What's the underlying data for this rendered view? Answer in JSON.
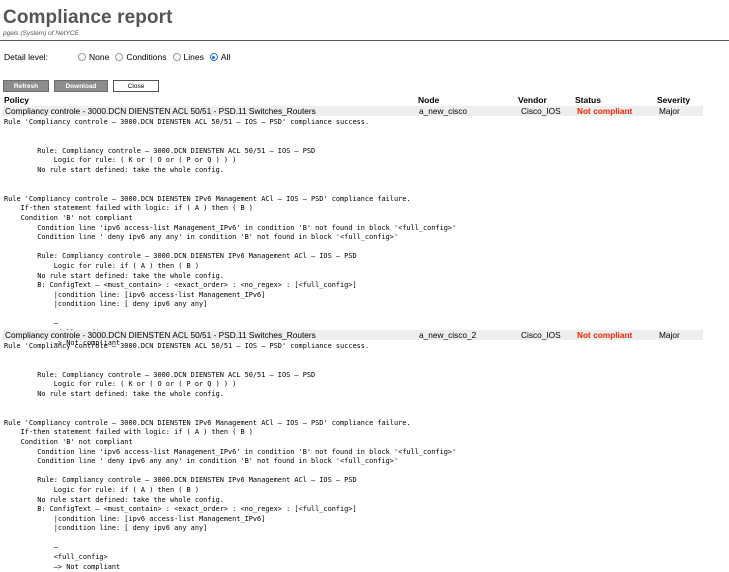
{
  "title": "Compliance report",
  "subtitle": "pgels (System) of NetYCE",
  "detail": {
    "label": "Detail level:",
    "options": [
      "None",
      "Conditions",
      "Lines",
      "All"
    ],
    "selected": "All"
  },
  "buttons": {
    "refresh": "Refresh",
    "download": "Download",
    "close": "Close"
  },
  "columns": {
    "policy": "Policy",
    "node": "Node",
    "vendor": "Vendor",
    "status": "Status",
    "severity": "Severity"
  },
  "rows": [
    {
      "policy": "Compliancy controle - 3000.DCN DIENSTEN ACL 50/51 - PSD.11 Switches_Routers",
      "node": "a_new_cisco",
      "vendor": "Cisco_IOS",
      "status": "Not compliant",
      "severity": "Major",
      "log": "Rule 'Compliancy controle – 3000.DCN DIENSTEN ACL 50/51 – IOS – PSD' compliance success.\n\n\n        Rule: Compliancy controle – 3000.DCN DIENSTEN ACL 50/51 – IOS – PSD\n            Logic for rule: ( K or ( O or ( P or Q ) ) )\n        No rule start defined: take the whole config.\n\n\nRule 'Compliancy controle – 3000.DCN DIENSTEN IPv6 Management ACl – IOS – PSD' compliance failure.\n    If-then statement failed with logic: if ( A ) then ( B )\n    Condition 'B' not compliant\n        Condition line 'ipv6 access-list Management_IPv6' in condition 'B' not found in block '<full_config>'\n        Condition line ' deny ipv6 any any' in condition 'B' not found in block '<full_config>'\n\n        Rule: Compliancy controle – 3000.DCN DIENSTEN IPv6 Management ACl – IOS – PSD\n            Logic for rule: if ( A ) then ( B )\n        No rule start defined: take the whole config.\n        B: ConfigText – <must_contain> : <exact_order> : <no_regex> : [<full_config>]\n            |condition line: [ipv6 access-list Management_IPv6]\n            |condition line: [ deny ipv6 any any]\n\n            –\n            <full_config>\n            –> Not compliant"
    },
    {
      "policy": "Compliancy controle - 3000.DCN DIENSTEN ACL 50/51 - PSD.11 Switches_Routers",
      "node": "a_new_cisco_2",
      "vendor": "Cisco_IOS",
      "status": "Not compliant",
      "severity": "Major",
      "log": "Rule 'Compliancy controle – 3000.DCN DIENSTEN ACL 50/51 – IOS – PSD' compliance success.\n\n\n        Rule: Compliancy controle – 3000.DCN DIENSTEN ACL 50/51 – IOS – PSD\n            Logic for rule: ( K or ( O or ( P or Q ) ) )\n        No rule start defined: take the whole config.\n\n\nRule 'Compliancy controle – 3000.DCN DIENSTEN IPv6 Management ACl – IOS – PSD' compliance failure.\n    If-then statement failed with logic: if ( A ) then ( B )\n    Condition 'B' not compliant\n        Condition line 'ipv6 access-list Management_IPv6' in condition 'B' not found in block '<full_config>'\n        Condition line ' deny ipv6 any any' in condition 'B' not found in block '<full_config>'\n\n        Rule: Compliancy controle – 3000.DCN DIENSTEN IPv6 Management ACl – IOS – PSD\n            Logic for rule: if ( A ) then ( B )\n        No rule start defined: take the whole config.\n        B: ConfigText – <must_contain> : <exact_order> : <no_regex> : [<full_config>]\n            |condition line: [ipv6 access-list Management_IPv6]\n            |condition line: [ deny ipv6 any any]\n\n            –\n            <full_config>\n            –> Not compliant"
    }
  ]
}
